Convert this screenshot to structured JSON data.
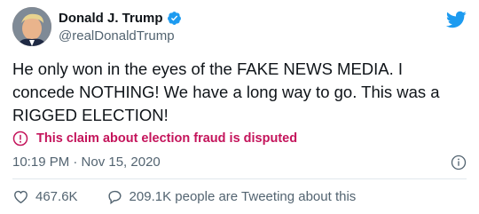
{
  "user": {
    "display_name": "Donald J. Trump",
    "handle": "@realDonaldTrump"
  },
  "tweet": {
    "text": "He only won in the eyes of the FAKE NEWS MEDIA. I concede NOTHING! We have a long way to go. This was a RIGGED ELECTION!",
    "disputed_label": "This claim about election fraud is disputed",
    "timestamp": "10:19 PM · Nov 15, 2020"
  },
  "stats": {
    "likes": "467.6K",
    "conversation": "209.1K people are Tweeting about this"
  },
  "colors": {
    "twitter_blue": "#1d9bf0",
    "dispute_red": "#c4145b",
    "secondary_text": "#536471"
  },
  "icons": [
    "avatar",
    "verified-badge-icon",
    "twitter-bird-icon",
    "alert-circle-icon",
    "info-icon",
    "heart-icon",
    "reply-bubble-icon"
  ]
}
